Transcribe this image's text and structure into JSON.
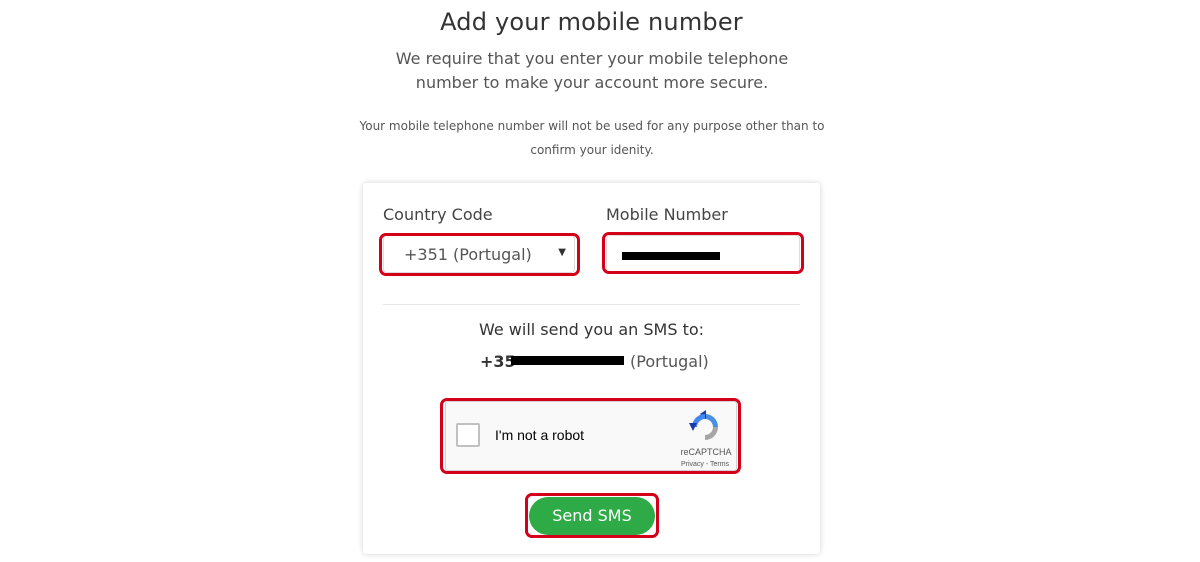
{
  "header": {
    "title": "Add your mobile number",
    "lead": "We require that you enter your mobile telephone number to make your account more secure.",
    "note": "Your mobile telephone number will not be used for any purpose other than to confirm your idenity."
  },
  "form": {
    "country_code_label": "Country Code",
    "country_code_value": "+351 (Portugal)",
    "mobile_number_label": "Mobile Number",
    "mobile_number_value": "[redacted]",
    "arrow_glyph": "▼"
  },
  "sms": {
    "intro": "We will send you an SMS to:",
    "prefix": "+35",
    "country": "(Portugal)"
  },
  "captcha": {
    "label": "I'm not a robot",
    "brand": "reCAPTCHA",
    "links": "Privacy - Terms"
  },
  "actions": {
    "send_label": "Send SMS"
  },
  "colors": {
    "primary_button": "#2eaa47",
    "highlight": "#d4001a",
    "redaction": "#000000"
  }
}
